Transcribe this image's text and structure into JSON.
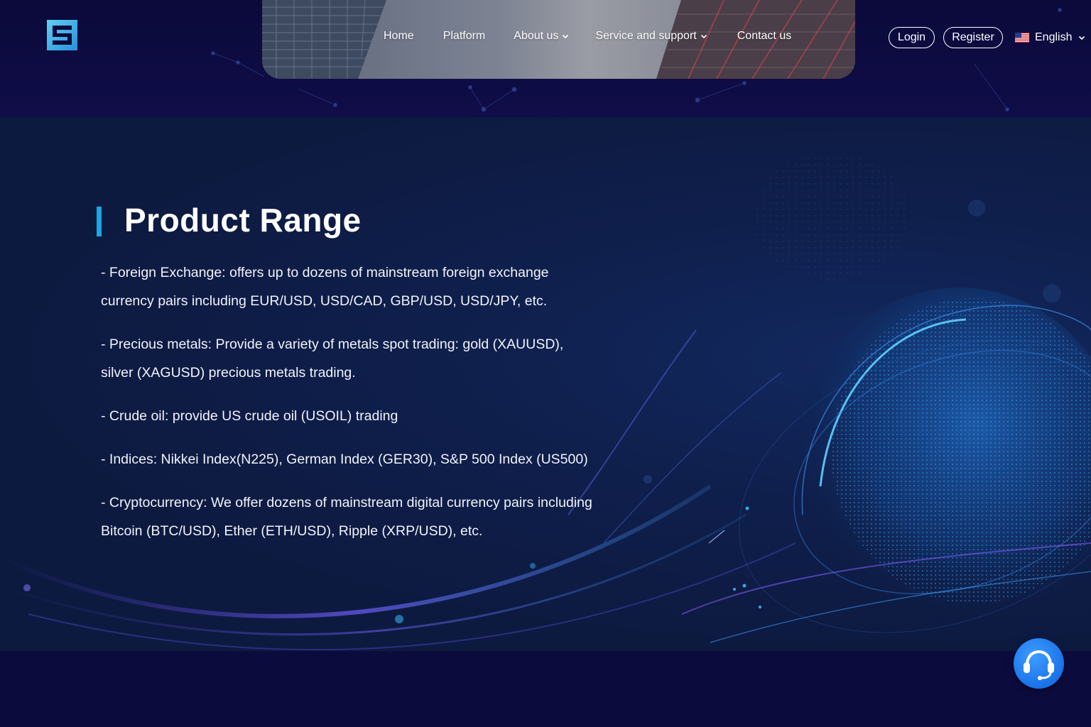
{
  "header": {
    "logo_icon": "brand-logo-icon",
    "nav": [
      {
        "label": "Home",
        "has_dropdown": false
      },
      {
        "label": "Platform",
        "has_dropdown": false
      },
      {
        "label": "About us",
        "has_dropdown": true
      },
      {
        "label": "Service and support",
        "has_dropdown": true
      },
      {
        "label": "Contact us",
        "has_dropdown": false
      }
    ],
    "login_label": "Login",
    "register_label": "Register",
    "language_label": "English",
    "language_flag_icon": "us-flag-icon"
  },
  "main": {
    "title": "Product Range",
    "items": [
      "- Foreign Exchange: offers up to dozens of mainstream foreign exchange currency pairs including EUR/USD, USD/CAD, GBP/USD, USD/JPY, etc.",
      "- Precious metals: Provide a variety of metals spot trading: gold (XAUUSD), silver (XAGUSD) precious metals trading.",
      "- Crude oil: provide US crude oil (USOIL) trading",
      "- Indices: Nikkei Index(N225), German Index (GER30), S&P 500 Index (US500)",
      "- Cryptocurrency: We offer dozens of mainstream digital currency pairs including Bitcoin (BTC/USD), Ether (ETH/USD), Ripple (XRP/USD), etc."
    ]
  },
  "support_icon": "headset-icon",
  "colors": {
    "accent": "#1aa7e0",
    "page_bg": "#0c0b3d",
    "section_bg": "#0d1a40",
    "support_button": "#1a73e8"
  }
}
